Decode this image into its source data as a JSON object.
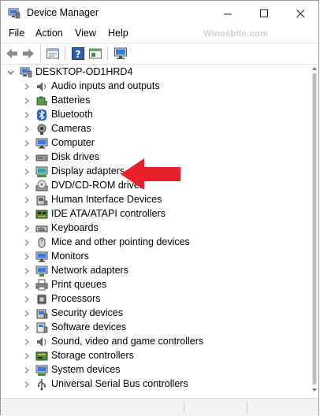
{
  "window": {
    "title": "Device Manager",
    "caption": {
      "minimize": "—",
      "maximize": "☐",
      "close": "✕"
    }
  },
  "menu": [
    "File",
    "Action",
    "View",
    "Help"
  ],
  "watermark": "Winosbite.com",
  "toolbar": {
    "buttons": [
      "back-icon",
      "forward-icon",
      "properties-icon",
      "help-icon",
      "show-hidden-icon",
      "monitor-icon"
    ]
  },
  "tree": {
    "root": {
      "label": "DESKTOP-OD1HRD4",
      "icon": "computer-icon",
      "expanded": true
    },
    "items": [
      {
        "label": "Audio inputs and outputs",
        "icon": "speaker-icon"
      },
      {
        "label": "Batteries",
        "icon": "battery-icon"
      },
      {
        "label": "Bluetooth",
        "icon": "bluetooth-icon"
      },
      {
        "label": "Cameras",
        "icon": "camera-icon"
      },
      {
        "label": "Computer",
        "icon": "monitor-icon"
      },
      {
        "label": "Disk drives",
        "icon": "disk-drive-icon"
      },
      {
        "label": "Display adapters",
        "icon": "display-adapter-icon"
      },
      {
        "label": "DVD/CD-ROM drives",
        "icon": "dvd-icon"
      },
      {
        "label": "Human Interface Devices",
        "icon": "hid-icon"
      },
      {
        "label": "IDE ATA/ATAPI controllers",
        "icon": "ide-controller-icon"
      },
      {
        "label": "Keyboards",
        "icon": "keyboard-icon"
      },
      {
        "label": "Mice and other pointing devices",
        "icon": "mouse-icon"
      },
      {
        "label": "Monitors",
        "icon": "monitor-icon"
      },
      {
        "label": "Network adapters",
        "icon": "network-icon"
      },
      {
        "label": "Print queues",
        "icon": "printer-icon"
      },
      {
        "label": "Processors",
        "icon": "processor-icon"
      },
      {
        "label": "Security devices",
        "icon": "security-icon"
      },
      {
        "label": "Software devices",
        "icon": "software-icon"
      },
      {
        "label": "Sound, video and game controllers",
        "icon": "sound-icon"
      },
      {
        "label": "Storage controllers",
        "icon": "storage-icon"
      },
      {
        "label": "System devices",
        "icon": "system-icon"
      },
      {
        "label": "Universal Serial Bus controllers",
        "icon": "usb-icon"
      }
    ]
  },
  "colors": {
    "annotation_arrow": "#e8202a",
    "folder_blue": "#3a7bd5"
  }
}
